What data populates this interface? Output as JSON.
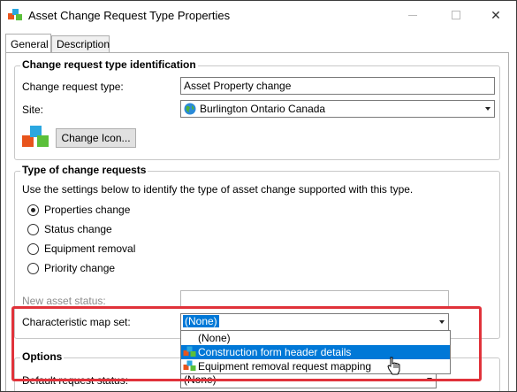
{
  "window": {
    "title": "Asset Change Request Type Properties",
    "controls": {
      "minimize": "minimize",
      "maximize": "maximize",
      "close": "✕"
    }
  },
  "tabs": [
    {
      "label": "General",
      "active": true
    },
    {
      "label": "Description",
      "active": false
    }
  ],
  "identification": {
    "group_title": "Change request type identification",
    "type_label": "Change request type:",
    "type_value": "Asset Property change",
    "site_label": "Site:",
    "site_value": "Burlington Ontario Canada",
    "change_icon_button": "Change Icon..."
  },
  "type_group": {
    "group_title": "Type of change requests",
    "instructions": "Use the settings below to identify the type of asset change supported with this type.",
    "options": [
      {
        "label": "Properties change",
        "checked": true
      },
      {
        "label": "Status change",
        "checked": false
      },
      {
        "label": "Equipment removal",
        "checked": false
      },
      {
        "label": "Priority change",
        "checked": false
      }
    ],
    "new_status_label": "New asset status:",
    "new_status_value": "",
    "char_map_label": "Characteristic map set:",
    "char_map_value": "(None)"
  },
  "dropdown": {
    "items": [
      {
        "label": "(None)",
        "icon": null,
        "selected": false
      },
      {
        "label": "Construction form header details",
        "icon": "asset-cubes-icon",
        "selected": true
      },
      {
        "label": "Equipment removal request mapping",
        "icon": "asset-cubes-icon",
        "selected": false
      }
    ]
  },
  "options_group": {
    "group_title": "Options",
    "default_status_label": "Default request status:",
    "default_status_value": "(None)"
  },
  "colors": {
    "highlight": "#e0323a",
    "selection": "#0078d7"
  }
}
